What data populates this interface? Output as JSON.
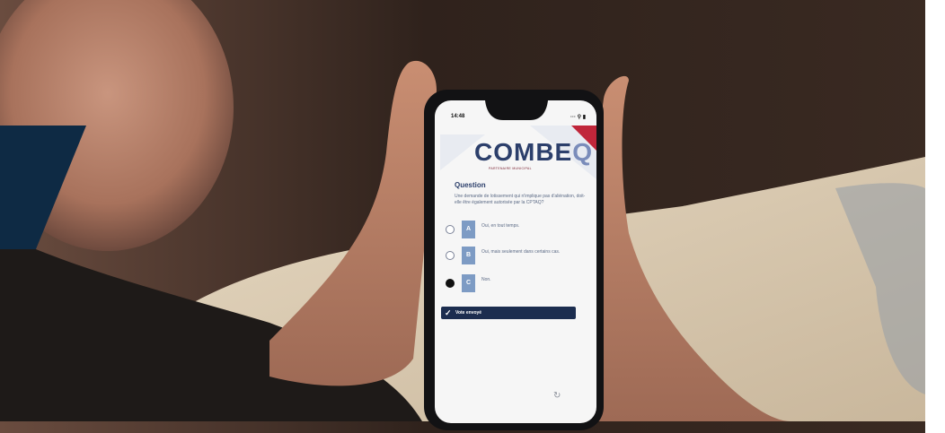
{
  "phone": {
    "status": {
      "time": "14:48",
      "icons": "··· ⚲ ▮"
    },
    "header": {
      "logo_main": "COMBE",
      "logo_end": "Q",
      "tagline": "PARTENAIRE MUNICIPAL"
    },
    "question": {
      "heading": "Question",
      "text": "Une demande de lotissement qui n'implique pas d'aliénation, doit-elle être également autorisée par la CPTAQ?"
    },
    "options": [
      {
        "letter": "A",
        "label": "Oui, en tout temps."
      },
      {
        "letter": "B",
        "label": "Oui, mais seulement dans certains cas."
      },
      {
        "letter": "C",
        "label": "Non.",
        "selected": true
      }
    ],
    "vote_status": "Vote envoyé"
  },
  "colors": {
    "brand_navy": "#1c2d4f",
    "logo_blue": "#2c3f6b",
    "option_letter_bg": "#7d9bc4",
    "corner_shape": "#0e2a44"
  },
  "icons": [
    "check-icon",
    "refresh-icon",
    "signal-icon",
    "battery-icon"
  ]
}
